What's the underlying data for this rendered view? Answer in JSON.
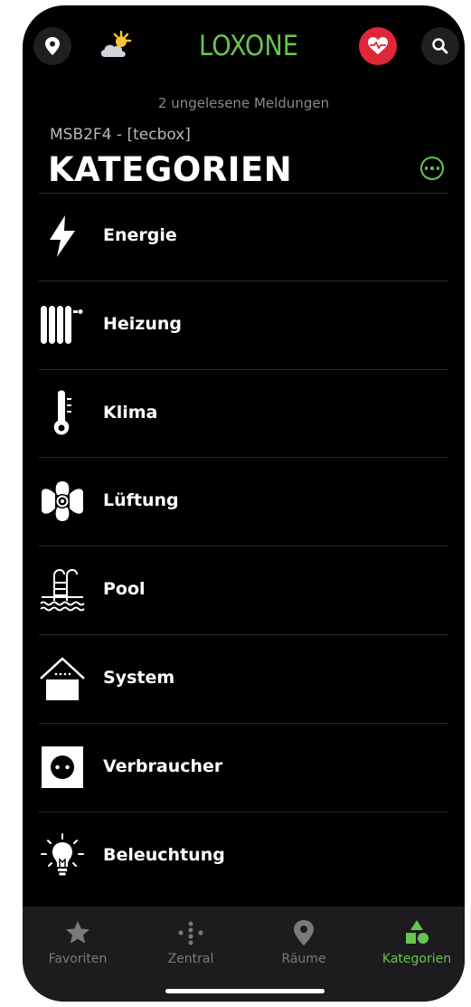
{
  "header": {
    "logo": "LOXONE",
    "messages": "2 ungelesene Meldungen",
    "server": "MSB2F4 - [tecbox]",
    "title": "KATEGORIEN",
    "accent_color": "#69c350",
    "health_color": "#e0263a"
  },
  "categories": [
    {
      "label": "Energie",
      "icon": "lightning-icon"
    },
    {
      "label": "Heizung",
      "icon": "radiator-icon"
    },
    {
      "label": "Klima",
      "icon": "thermometer-icon"
    },
    {
      "label": "Lüftung",
      "icon": "fan-icon"
    },
    {
      "label": "Pool",
      "icon": "pool-ladder-icon"
    },
    {
      "label": "System",
      "icon": "house-icon"
    },
    {
      "label": "Verbraucher",
      "icon": "power-socket-icon"
    },
    {
      "label": "Beleuchtung",
      "icon": "lightbulb-icon"
    }
  ],
  "tabs": [
    {
      "label": "Favoriten",
      "icon": "star-icon",
      "active": false
    },
    {
      "label": "Zentral",
      "icon": "dots-cross-icon",
      "active": false
    },
    {
      "label": "Räume",
      "icon": "location-pin-icon",
      "active": false
    },
    {
      "label": "Kategorien",
      "icon": "shapes-icon",
      "active": true
    }
  ]
}
